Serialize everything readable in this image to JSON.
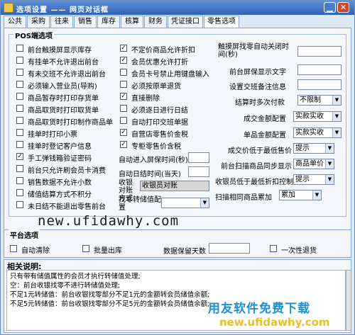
{
  "window": {
    "title": "选项设置 —— 网页对话框"
  },
  "tabs": [
    "公共",
    "采购",
    "往来",
    "销售",
    "库存",
    "核算",
    "财务",
    "凭证接口",
    "零售选项"
  ],
  "pos": {
    "legend": "POS端选项",
    "col1": [
      {
        "label": "前台触摸屏显示库存",
        "checked": false
      },
      {
        "label": "有挂单不允许退出前台",
        "checked": false
      },
      {
        "label": "有未交班不允许退出前台",
        "checked": false
      },
      {
        "label": "必须输入营业员(导购)",
        "checked": false
      },
      {
        "label": "商品暂存时打印存货单",
        "checked": false
      },
      {
        "label": "商品取货时打印取货单",
        "checked": false
      },
      {
        "label": "商品取货时打印制作商品单",
        "checked": false
      },
      {
        "label": "挂单时打印小票",
        "checked": false
      },
      {
        "label": "挂单时登记客户信息",
        "checked": false
      },
      {
        "label": "手工弹钱箱验证密码",
        "checked": true
      },
      {
        "label": "前台只允许刷会员卡消费",
        "checked": false
      },
      {
        "label": "销售数据不允许小数",
        "checked": false
      },
      {
        "label": "储值结算方式不积分",
        "checked": false
      },
      {
        "label": "未日结不能退出零售前台",
        "checked": false
      }
    ],
    "col2": [
      {
        "label": "不定价商品允许折扣",
        "checked": true
      },
      {
        "label": "会员优惠允许打折",
        "checked": true
      },
      {
        "label": "会员卡号禁止用键盘输入",
        "checked": false
      },
      {
        "label": "必须按原单退货",
        "checked": false
      },
      {
        "label": "直接删除",
        "checked": true
      },
      {
        "label": "必须逐日进行日结",
        "checked": false
      },
      {
        "label": "自动打印交班单据",
        "checked": false
      },
      {
        "label": "自营店零售价金税",
        "checked": true
      },
      {
        "label": "专柜零售价含税",
        "checked": true
      }
    ],
    "auto_lock_label": "自动进入屏保时间(秒)",
    "auto_settle_label": "自动日结时间(当天)",
    "cash_method_label": "收银对账方式",
    "cash_method_value": "收银员对账",
    "change_label": "找零转储值配置",
    "right": {
      "touch_close_label": "触摸屏找零自动关闭时间(秒)",
      "screensaver_label": "前台屏保显示文字",
      "remark_label": "设置交班备注信息",
      "multi_pay_label": "结算时多次付款",
      "multi_pay_value": "不限制",
      "amount_label": "成交金额配置",
      "amount_value": "实款实收",
      "unit_label": "单品金额配置",
      "unit_value": "实款实收",
      "lowprice_label": "成交价低于最低售价",
      "lowprice_value": "提示",
      "scan_sync_label": "前台扫描商品同步显示",
      "scan_sync_value": "商品单价",
      "lowdisc_label": "收银员低于最低折扣控制",
      "lowdisc_value": "提示",
      "scan_same_label": "扫描相同商品累加",
      "scan_same_value": "累加"
    }
  },
  "watermark": "new.ufidawhy.com",
  "platform": {
    "legend": "平台选项",
    "auto_clear": "自动清除",
    "batch_out": "批量出库",
    "keep_days_label": "数据保留天数",
    "one_time_return": "一次性退货"
  },
  "notes": {
    "header": "相关说明:",
    "lines": [
      "只有带有储值属性的会员才执行转储值处理;",
      "空：前台收银找零不进行转储值处理;",
      "不足1元转储值：前台收银找零部分不足1元的金额转会员储值余额;",
      "不足5元转储值：前台收银找零部分不足5元的金额转会员储值余额;"
    ]
  },
  "brand": {
    "line1": "用友软件免费下载",
    "line2": "new.ufidawhy.com"
  },
  "colors": {
    "title_bar": "#2f62b3",
    "brand_blue": "#1d8fd0",
    "brand_yellow": "#e8c020"
  }
}
